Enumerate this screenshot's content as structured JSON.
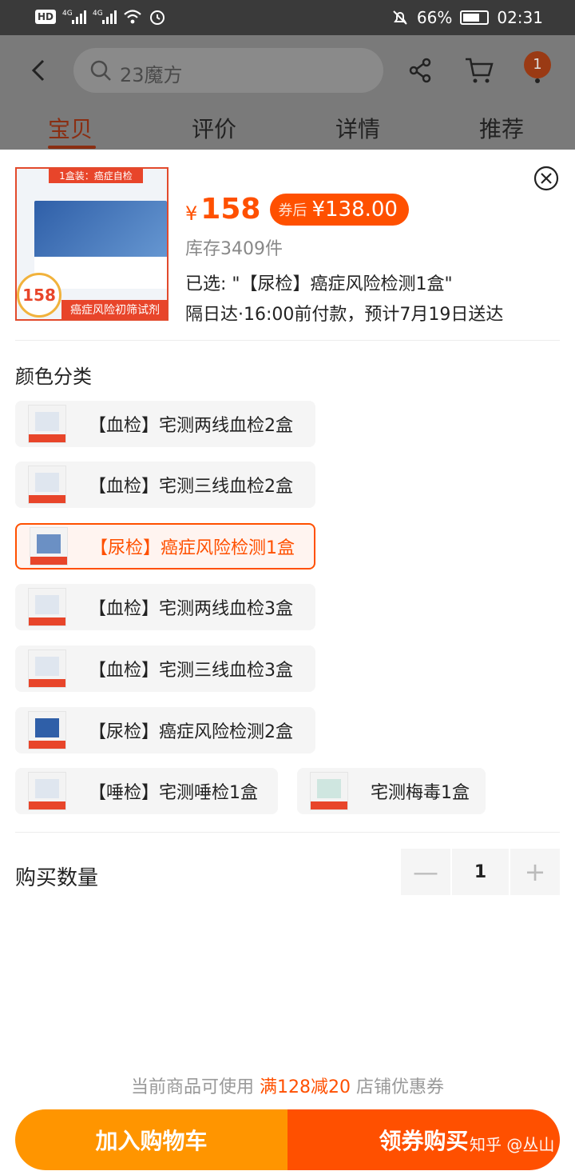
{
  "status_bar": {
    "battery": "66%",
    "time": "02:31",
    "signal1": "4G",
    "signal2": "4G",
    "hd": "HD"
  },
  "header": {
    "search_placeholder": "23魔方",
    "cart_badge": "1",
    "tabs": [
      "宝贝",
      "评价",
      "详情",
      "推荐"
    ],
    "active_tab": "宝贝"
  },
  "product": {
    "thumb_top_text": "1盒装：癌症自检",
    "thumb_bottom_text": "癌症风险初筛试剂",
    "thumb_price": "158",
    "currency": "¥",
    "price": "158",
    "coupon_tag": "券后",
    "coupon_price": "¥138.00",
    "stock": "库存3409件",
    "selected": "已选: \"【尿检】癌症风险检测1盒\"",
    "delivery": "隔日达·16:00前付款，预计7月19日送达"
  },
  "color_section": {
    "title": "颜色分类",
    "options": [
      {
        "label": "【血检】宅测两线血检2盒",
        "selected": false
      },
      {
        "label": "【血检】宅测三线血检2盒",
        "selected": false
      },
      {
        "label": "【尿检】癌症风险检测1盒",
        "selected": true
      },
      {
        "label": "【血检】宅测两线血检3盒",
        "selected": false
      },
      {
        "label": "【血检】宅测三线血检3盒",
        "selected": false
      },
      {
        "label": "【尿检】癌症风险检测2盒",
        "selected": false
      },
      {
        "label": "【唾检】宅测唾检1盒",
        "selected": false
      },
      {
        "label": "宅测梅毒1盒",
        "selected": false
      }
    ]
  },
  "quantity": {
    "label": "购买数量",
    "value": "1",
    "minus": "—",
    "plus": "+"
  },
  "footer": {
    "coupon_tip_prefix": "当前商品可使用 ",
    "coupon_tip_highlight": "满128减20",
    "coupon_tip_suffix": " 店铺优惠券",
    "add_to_cart": "加入购物车",
    "buy_with_coupon": "领券购买",
    "watermark": "知乎 @丛山"
  },
  "colors": {
    "accent": "#ff5000",
    "cart_button": "#ff9500"
  }
}
